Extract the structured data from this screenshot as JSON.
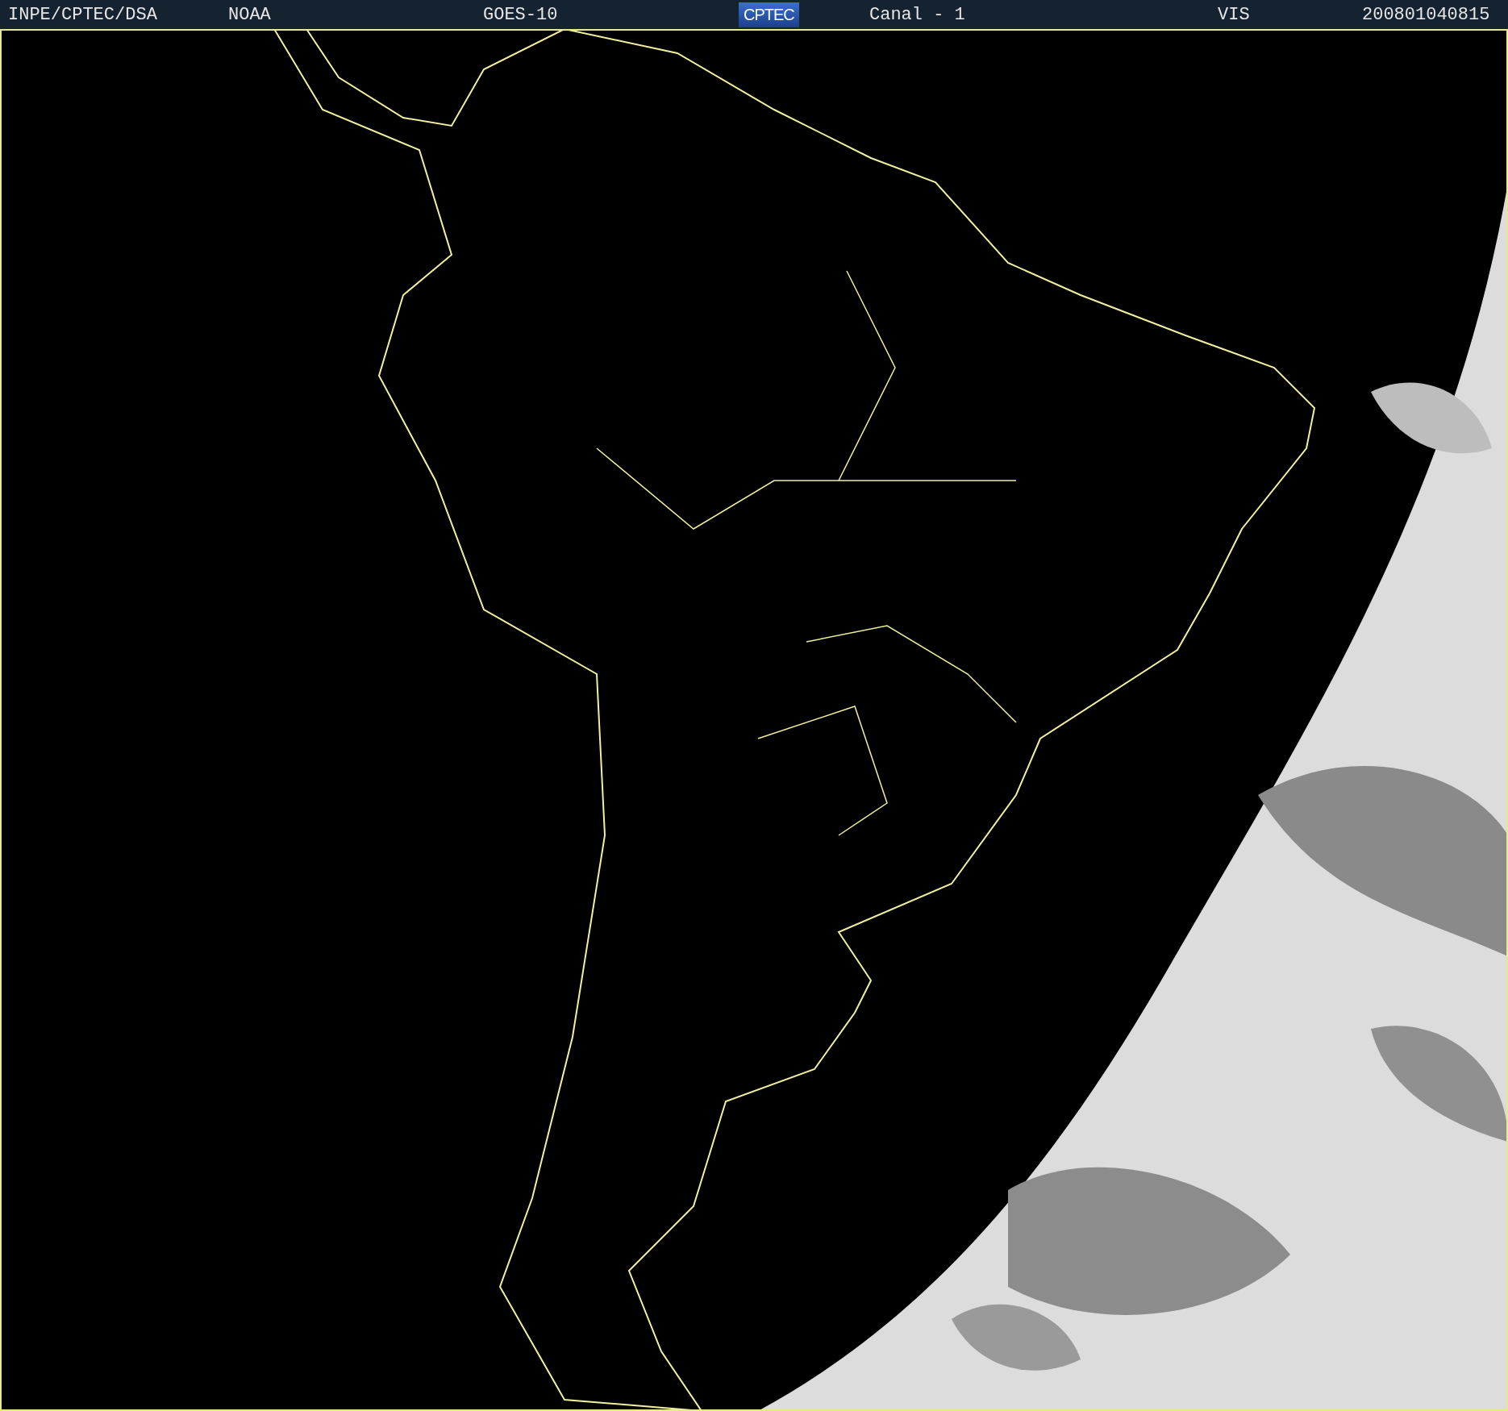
{
  "header": {
    "items": [
      {
        "kind": "text",
        "text": "INPE/CPTEC/DSA"
      },
      {
        "kind": "text",
        "text": "NOAA"
      },
      {
        "kind": "text",
        "text": "GOES-10"
      },
      {
        "kind": "logo",
        "text": "CPTEC"
      },
      {
        "kind": "text",
        "text": "Canal - 1"
      },
      {
        "kind": "text",
        "text": "VIS"
      },
      {
        "kind": "text",
        "text": "200801040815"
      }
    ]
  }
}
